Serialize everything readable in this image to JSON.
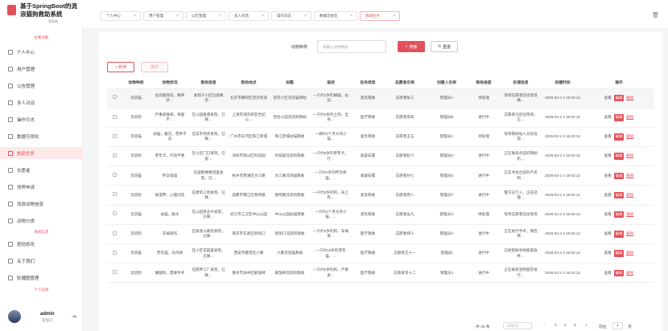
{
  "app": {
    "title": "基于SpringBoot的流浪猫狗救助系统",
    "subtitle": "管理端"
  },
  "sidebar": {
    "section_main": "主要功能",
    "section_system": "系统信息",
    "section_personal": "个人信息",
    "items": [
      {
        "label": "个人中心",
        "icon": "user-icon"
      },
      {
        "label": "用户管理",
        "icon": "users-icon"
      },
      {
        "label": "公告管理",
        "icon": "notice-icon"
      },
      {
        "label": "多人对话",
        "icon": "chat-icon"
      },
      {
        "label": "操作日志",
        "icon": "log-icon"
      },
      {
        "label": "数据可视化",
        "icon": "chart-icon"
      },
      {
        "label": "救助任务",
        "icon": "task-icon",
        "active": true
      },
      {
        "label": "志愿者",
        "icon": "volunteer-icon"
      },
      {
        "label": "领养申请",
        "icon": "adopt-icon"
      },
      {
        "label": "流浪动物信息",
        "icon": "animal-icon"
      },
      {
        "label": "动物分类",
        "icon": "category-icon"
      },
      {
        "label": "密码修改",
        "icon": "lock-icon"
      },
      {
        "label": "关于我们",
        "icon": "info-icon"
      },
      {
        "label": "轮播图管理",
        "icon": "image-icon"
      }
    ],
    "user": {
      "name": "admin",
      "role": "管理员"
    }
  },
  "tabs": [
    {
      "label": "个人中心"
    },
    {
      "label": "用户管理"
    },
    {
      "label": "公告管理"
    },
    {
      "label": "多人对话"
    },
    {
      "label": "操作日志"
    },
    {
      "label": "数据可视化"
    },
    {
      "label": "救助任务",
      "active": true
    }
  ],
  "search": {
    "label": "动物种类",
    "placeholder": "请输入动物种类",
    "search_btn": "搜索",
    "reset_btn": "重置"
  },
  "toolbar": {
    "add": "+ 新增",
    "delete": "删除"
  },
  "table": {
    "headers": [
      "动物种类",
      "动物状况",
      "救助信息",
      "救助地点",
      "标题",
      "描述",
      "任务类型",
      "志愿者名称",
      "创建人名称",
      "救助进度",
      "处理信息",
      "创建时间",
      "操作"
    ],
    "actions": {
      "view": "查看",
      "edit": "编辑",
      "delete": "删除"
    },
    "rows": [
      [
        "流浪猫",
        "右前腿受伤，精神状…",
        "发现于小区垃圾桶旁…",
        "北京市朝阳区望京街道",
        "望京小区流浪猫救助",
        "一只约1岁的橘猫，右前…",
        "紧急救助",
        "志愿者张三",
        "管理员A",
        "待处理",
        "等待志愿者前往现场确…",
        "2026-02-2 4 16:02:12"
      ],
      [
        "流浪狗",
        "严重皮肤病，骨瘦不…",
        "在公园角落发现，已联…",
        "上海市浦东新区世纪公…",
        "世纪公园流浪狗救助",
        "一只约3岁的土狗，全身…",
        "医疗救助",
        "志愿者李四",
        "管理员B",
        "进行中",
        "志愿者已前往现场，正…",
        "2026-02-2 4 16:02:12"
      ],
      [
        "流浪猫",
        "幼猫，腹泻，营养不良",
        "在菜市场旁发现，已联…",
        "广州市天河区珠江新城",
        "珠江新城幼猫救助",
        "一窝约3个月大的小猫…",
        "紧急救助",
        "志愿者王五",
        "管理员C",
        "待处理",
        "等待救助站人员前往现…",
        "2026-02-2 4 16:02:12"
      ],
      [
        "流浪狗",
        "老年犬，行动不便",
        "在小区门口发现，已提…",
        "深圳市南山区科技园",
        "科技园流浪狗救助",
        "一只约8岁的老年犬，行…",
        "收容安置",
        "志愿者赵六",
        "管理员D",
        "进行中",
        "正在联系合适的救助机…",
        "2026-02-2 4 16:02:12"
      ],
      [
        "流浪猫",
        "怀孕母猫",
        "在居民楼楼道里发现，已…",
        "杭州市西湖区文三路",
        "文三路流浪猫救助",
        "一只约2岁的怀孕母猫，…",
        "收容安置",
        "志愿者孙七",
        "管理员E",
        "进行中",
        "正在寻找合适的产房和…",
        "2026-02-2 4 16:02:12"
      ],
      [
        "流浪狗",
        "被遗弃，心理创伤",
        "在建筑工地发现，已联…",
        "成都市锦江区春熙路",
        "春熙路流浪狗救助",
        "一只约2岁的狗，身上有…",
        "紧急救助",
        "志愿者周八",
        "管理员F",
        "进行中",
        "警方已介入，正在处理…",
        "2026-02-2 4 16:02:12"
      ],
      [
        "流浪猫",
        "幼猫，脱水",
        "在公园草丛中发现，已联…",
        "武汉市江汉区中山公园",
        "中山公园幼猫救助",
        "一只约2个月大的小猫，…",
        "紧急救助",
        "志愿者吴九",
        "管理员G",
        "待处理",
        "等待志愿者前往现场",
        "2026-02-2 4 16:02:12"
      ],
      [
        "流浪狗",
        "车祸受伤",
        "在高速公路旁发现，已联…",
        "南京市玄武区新街口",
        "新街口流浪狗救助",
        "一只约4岁的狗，车祸受…",
        "医疗救助",
        "志愿者郑十",
        "管理员H",
        "进行中",
        "正在进行手术，预后情…",
        "2026-02-2 4 16:02:12"
      ],
      [
        "流浪猫",
        "老年猫，白内障",
        "在小区花园里发现，已联…",
        "西安市雁塔区小寨",
        "小寨流浪猫救助",
        "一只约10岁的老年猫，…",
        "医疗救助",
        "志愿者王十一",
        "管理员I",
        "进行中",
        "已经帮助寻找家庭收养…",
        "2026-02-2 4 16:02:12"
      ],
      [
        "流浪狗",
        "瘸腿狗，需要手术",
        "在废弃工厂发现，已联…",
        "重庆市渝中区解放碑",
        "解放碑流浪狗救助",
        "一只约5岁的狗，严重皮…",
        "医疗救助",
        "志愿者李十二",
        "管理员J",
        "进行中",
        "正在联系宠物医院进行…",
        "2026-02-2 4 16:02:12"
      ]
    ]
  },
  "pagination": {
    "total": "共 30 条",
    "page_size": "10条/页",
    "prev": "<",
    "pages": [
      "1",
      "2",
      "3"
    ],
    "next": ">",
    "goto_prefix": "前往",
    "goto_value": "1",
    "goto_suffix": "页"
  }
}
